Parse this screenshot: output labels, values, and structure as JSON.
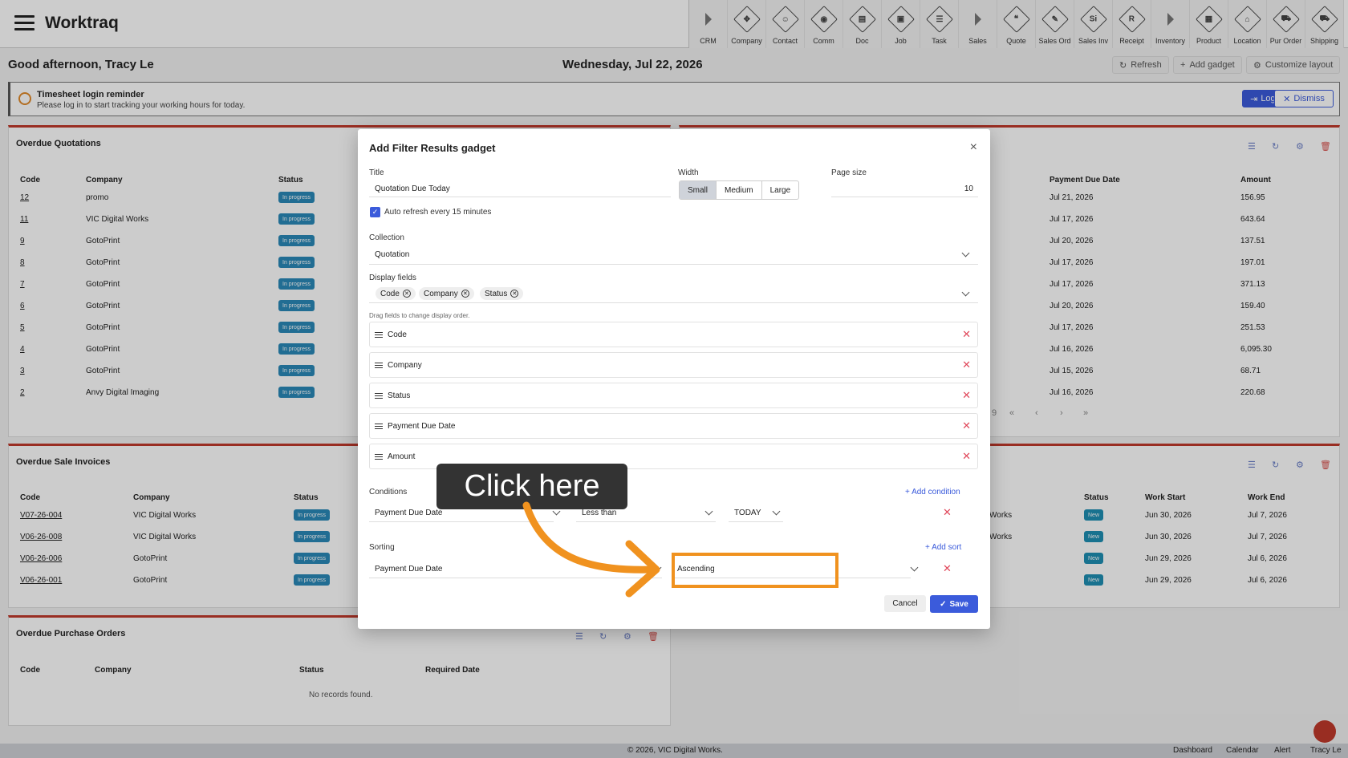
{
  "app": {
    "name": "Worktraq"
  },
  "nav": [
    {
      "label": "CRM",
      "icon": "arrow-icon"
    },
    {
      "label": "Company",
      "icon": "company-icon",
      "glyph": "✥"
    },
    {
      "label": "Contact",
      "icon": "contact-icon",
      "glyph": "☺"
    },
    {
      "label": "Comm",
      "icon": "comm-icon",
      "glyph": "◉"
    },
    {
      "label": "Doc",
      "icon": "doc-icon",
      "glyph": "▤"
    },
    {
      "label": "Job",
      "icon": "job-icon",
      "glyph": "▣"
    },
    {
      "label": "Task",
      "icon": "task-icon",
      "glyph": "☰"
    },
    {
      "label": "Sales",
      "icon": "arrow-icon"
    },
    {
      "label": "Quote",
      "icon": "quote-icon",
      "glyph": "❝"
    },
    {
      "label": "Sales Ord",
      "icon": "sales-order-icon",
      "glyph": "✎"
    },
    {
      "label": "Sales Inv",
      "icon": "sales-invoice-icon",
      "glyph": "Si"
    },
    {
      "label": "Receipt",
      "icon": "receipt-icon",
      "glyph": "R"
    },
    {
      "label": "Inventory",
      "icon": "arrow-icon"
    },
    {
      "label": "Product",
      "icon": "product-icon",
      "glyph": "▦"
    },
    {
      "label": "Location",
      "icon": "location-icon",
      "glyph": "⌂"
    },
    {
      "label": "Pur Order",
      "icon": "purchase-order-icon",
      "glyph": "⛟"
    },
    {
      "label": "Shipping",
      "icon": "shipping-icon",
      "glyph": "⛟"
    }
  ],
  "header": {
    "greeting": "Good afternoon, Tracy Le",
    "date": "Wednesday, Jul 22, 2026",
    "refresh": "Refresh",
    "add_gadget": "Add gadget",
    "customize": "Customize layout"
  },
  "reminder": {
    "title": "Timesheet login reminder",
    "text": "Please log in to start tracking your working hours for today.",
    "login": "Log In",
    "dismiss": "Dismiss"
  },
  "quotations": {
    "title": "Overdue Quotations",
    "headers": [
      "Code",
      "Company",
      "Status"
    ],
    "right_headers": [
      "Payment Due Date",
      "Amount"
    ],
    "rows": [
      {
        "code": "12",
        "company": "promo",
        "status": "In progress",
        "due": "Jul 21, 2026",
        "amount": "156.95"
      },
      {
        "code": "11",
        "company": "VIC Digital Works",
        "status": "In progress",
        "due": "Jul 17, 2026",
        "amount": "643.64"
      },
      {
        "code": "9",
        "company": "GotoPrint",
        "status": "In progress",
        "due": "Jul 20, 2026",
        "amount": "137.51"
      },
      {
        "code": "8",
        "company": "GotoPrint",
        "status": "In progress",
        "due": "Jul 17, 2026",
        "amount": "197.01"
      },
      {
        "code": "7",
        "company": "GotoPrint",
        "status": "In progress",
        "due": "Jul 17, 2026",
        "amount": "371.13"
      },
      {
        "code": "6",
        "company": "GotoPrint",
        "status": "In progress",
        "due": "Jul 20, 2026",
        "amount": "159.40"
      },
      {
        "code": "5",
        "company": "GotoPrint",
        "status": "In progress",
        "due": "Jul 17, 2026",
        "amount": "251.53"
      },
      {
        "code": "4",
        "company": "GotoPrint",
        "status": "In progress",
        "due": "Jul 16, 2026",
        "amount": "6,095.30"
      },
      {
        "code": "3",
        "company": "GotoPrint",
        "status": "In progress",
        "due": "Jul 15, 2026",
        "amount": "68.71"
      },
      {
        "code": "2",
        "company": "Anvy Digital Imaging",
        "status": "In progress",
        "due": "Jul 16, 2026",
        "amount": "220.68"
      }
    ],
    "pager": {
      "last": "9",
      "first": "«",
      "prev": "‹",
      "next": "›",
      "end": "»"
    }
  },
  "invoices": {
    "title": "Overdue Sale Invoices",
    "headers": [
      "Code",
      "Company",
      "Status"
    ],
    "rows": [
      {
        "code": "V07-26-004",
        "company": "VIC Digital Works",
        "status": "In progress"
      },
      {
        "code": "V06-26-008",
        "company": "VIC Digital Works",
        "status": "In progress"
      },
      {
        "code": "V06-26-006",
        "company": "GotoPrint",
        "status": "In progress"
      },
      {
        "code": "V06-26-001",
        "company": "GotoPrint",
        "status": "In progress"
      }
    ]
  },
  "jobs": {
    "headers": [
      "Status",
      "Work Start",
      "Work End"
    ],
    "rows": [
      {
        "company": "Works",
        "status": "New",
        "start": "Jun 30, 2026",
        "end": "Jul 7, 2026"
      },
      {
        "company": "Works",
        "status": "New",
        "start": "Jun 30, 2026",
        "end": "Jul 7, 2026"
      },
      {
        "company": "",
        "status": "New",
        "start": "Jun 29, 2026",
        "end": "Jul 6, 2026"
      },
      {
        "company": "",
        "status": "New",
        "start": "Jun 29, 2026",
        "end": "Jul 6, 2026"
      }
    ]
  },
  "purchases": {
    "title": "Overdue Purchase Orders",
    "headers": [
      "Code",
      "Company",
      "Status",
      "Required Date"
    ],
    "empty": "No records found."
  },
  "modal": {
    "title": "Add Filter Results gadget",
    "close": "×",
    "title_label": "Title",
    "title_value": "Quotation Due Today",
    "width_label": "Width",
    "widths": [
      "Small",
      "Medium",
      "Large"
    ],
    "width_selected": "Small",
    "page_size_label": "Page size",
    "page_size": "10",
    "auto_refresh": "Auto refresh every 15 minutes",
    "auto_refresh_checked": true,
    "collection_label": "Collection",
    "collection": "Quotation",
    "display_label": "Display fields",
    "chips": [
      "Code",
      "Company",
      "Status"
    ],
    "drag_hint": "Drag fields to change display order.",
    "fields": [
      "Code",
      "Company",
      "Status",
      "Payment Due Date",
      "Amount"
    ],
    "conditions_label": "Conditions",
    "add_condition": "Add condition",
    "condition": {
      "field": "Payment Due Date",
      "op": "Less than",
      "value": "TODAY"
    },
    "sorting_label": "Sorting",
    "add_sort": "Add sort",
    "sort": {
      "field": "Payment Due Date",
      "dir": "Ascending"
    },
    "cancel": "Cancel",
    "save": "Save"
  },
  "tutorial": {
    "tip": "Click here",
    "highlight_color": "#f0921f"
  },
  "footer": {
    "copyright": "© 2026, VIC Digital Works.",
    "links": [
      "Dashboard",
      "Calendar",
      "Alert",
      "Tracy Le"
    ]
  },
  "colors": {
    "accent": "#3b5bdb",
    "status_in_progress": "#2a89b8",
    "status_new": "#1f8fb3",
    "danger": "#c0392b"
  }
}
